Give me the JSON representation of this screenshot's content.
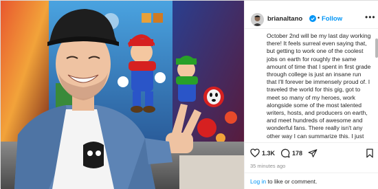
{
  "post": {
    "username": "brianaltano",
    "follow_label": "Follow",
    "separator": "•",
    "more_label": "•••",
    "caption": "October 2nd will be my last day working there! It feels surreal even saying that, but getting to work one of the coolest jobs on earth for roughly the same amount of time that I spent in first grade through college is just an insane run that I'll forever be immensely proud of. I traveled the world for this gig, got to meet so many of my heroes, work alongside some of the most talented writers, hosts, and producers on earth, and meet hundreds of awesome and wonderful fans. There really isn't any other way I can summarize this. I just feel so lucky I got to do this thing for so",
    "likes": "1.3K",
    "comments": "178",
    "timestamp": "35 minutes ago",
    "login": {
      "link": "Log in",
      "text": " to like or comment."
    }
  },
  "icons": {
    "verified": "verified-badge-icon",
    "like": "heart-icon",
    "comment": "comment-icon",
    "share": "send-icon",
    "save": "bookmark-icon",
    "more": "more-options-icon"
  },
  "colors": {
    "accent": "#0095f6",
    "text": "#262626",
    "muted": "#8e8e8e"
  }
}
